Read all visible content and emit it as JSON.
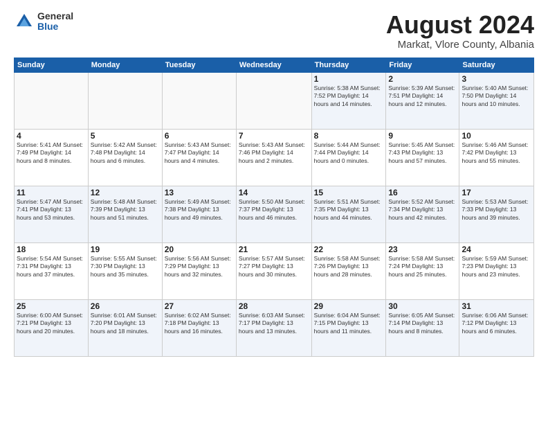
{
  "logo": {
    "general": "General",
    "blue": "Blue"
  },
  "header": {
    "month_year": "August 2024",
    "location": "Markat, Vlore County, Albania"
  },
  "weekdays": [
    "Sunday",
    "Monday",
    "Tuesday",
    "Wednesday",
    "Thursday",
    "Friday",
    "Saturday"
  ],
  "weeks": [
    [
      {
        "day": "",
        "info": ""
      },
      {
        "day": "",
        "info": ""
      },
      {
        "day": "",
        "info": ""
      },
      {
        "day": "",
        "info": ""
      },
      {
        "day": "1",
        "info": "Sunrise: 5:38 AM\nSunset: 7:52 PM\nDaylight: 14 hours\nand 14 minutes."
      },
      {
        "day": "2",
        "info": "Sunrise: 5:39 AM\nSunset: 7:51 PM\nDaylight: 14 hours\nand 12 minutes."
      },
      {
        "day": "3",
        "info": "Sunrise: 5:40 AM\nSunset: 7:50 PM\nDaylight: 14 hours\nand 10 minutes."
      }
    ],
    [
      {
        "day": "4",
        "info": "Sunrise: 5:41 AM\nSunset: 7:49 PM\nDaylight: 14 hours\nand 8 minutes."
      },
      {
        "day": "5",
        "info": "Sunrise: 5:42 AM\nSunset: 7:48 PM\nDaylight: 14 hours\nand 6 minutes."
      },
      {
        "day": "6",
        "info": "Sunrise: 5:43 AM\nSunset: 7:47 PM\nDaylight: 14 hours\nand 4 minutes."
      },
      {
        "day": "7",
        "info": "Sunrise: 5:43 AM\nSunset: 7:46 PM\nDaylight: 14 hours\nand 2 minutes."
      },
      {
        "day": "8",
        "info": "Sunrise: 5:44 AM\nSunset: 7:44 PM\nDaylight: 14 hours\nand 0 minutes."
      },
      {
        "day": "9",
        "info": "Sunrise: 5:45 AM\nSunset: 7:43 PM\nDaylight: 13 hours\nand 57 minutes."
      },
      {
        "day": "10",
        "info": "Sunrise: 5:46 AM\nSunset: 7:42 PM\nDaylight: 13 hours\nand 55 minutes."
      }
    ],
    [
      {
        "day": "11",
        "info": "Sunrise: 5:47 AM\nSunset: 7:41 PM\nDaylight: 13 hours\nand 53 minutes."
      },
      {
        "day": "12",
        "info": "Sunrise: 5:48 AM\nSunset: 7:39 PM\nDaylight: 13 hours\nand 51 minutes."
      },
      {
        "day": "13",
        "info": "Sunrise: 5:49 AM\nSunset: 7:38 PM\nDaylight: 13 hours\nand 49 minutes."
      },
      {
        "day": "14",
        "info": "Sunrise: 5:50 AM\nSunset: 7:37 PM\nDaylight: 13 hours\nand 46 minutes."
      },
      {
        "day": "15",
        "info": "Sunrise: 5:51 AM\nSunset: 7:35 PM\nDaylight: 13 hours\nand 44 minutes."
      },
      {
        "day": "16",
        "info": "Sunrise: 5:52 AM\nSunset: 7:34 PM\nDaylight: 13 hours\nand 42 minutes."
      },
      {
        "day": "17",
        "info": "Sunrise: 5:53 AM\nSunset: 7:33 PM\nDaylight: 13 hours\nand 39 minutes."
      }
    ],
    [
      {
        "day": "18",
        "info": "Sunrise: 5:54 AM\nSunset: 7:31 PM\nDaylight: 13 hours\nand 37 minutes."
      },
      {
        "day": "19",
        "info": "Sunrise: 5:55 AM\nSunset: 7:30 PM\nDaylight: 13 hours\nand 35 minutes."
      },
      {
        "day": "20",
        "info": "Sunrise: 5:56 AM\nSunset: 7:29 PM\nDaylight: 13 hours\nand 32 minutes."
      },
      {
        "day": "21",
        "info": "Sunrise: 5:57 AM\nSunset: 7:27 PM\nDaylight: 13 hours\nand 30 minutes."
      },
      {
        "day": "22",
        "info": "Sunrise: 5:58 AM\nSunset: 7:26 PM\nDaylight: 13 hours\nand 28 minutes."
      },
      {
        "day": "23",
        "info": "Sunrise: 5:58 AM\nSunset: 7:24 PM\nDaylight: 13 hours\nand 25 minutes."
      },
      {
        "day": "24",
        "info": "Sunrise: 5:59 AM\nSunset: 7:23 PM\nDaylight: 13 hours\nand 23 minutes."
      }
    ],
    [
      {
        "day": "25",
        "info": "Sunrise: 6:00 AM\nSunset: 7:21 PM\nDaylight: 13 hours\nand 20 minutes."
      },
      {
        "day": "26",
        "info": "Sunrise: 6:01 AM\nSunset: 7:20 PM\nDaylight: 13 hours\nand 18 minutes."
      },
      {
        "day": "27",
        "info": "Sunrise: 6:02 AM\nSunset: 7:18 PM\nDaylight: 13 hours\nand 16 minutes."
      },
      {
        "day": "28",
        "info": "Sunrise: 6:03 AM\nSunset: 7:17 PM\nDaylight: 13 hours\nand 13 minutes."
      },
      {
        "day": "29",
        "info": "Sunrise: 6:04 AM\nSunset: 7:15 PM\nDaylight: 13 hours\nand 11 minutes."
      },
      {
        "day": "30",
        "info": "Sunrise: 6:05 AM\nSunset: 7:14 PM\nDaylight: 13 hours\nand 8 minutes."
      },
      {
        "day": "31",
        "info": "Sunrise: 6:06 AM\nSunset: 7:12 PM\nDaylight: 13 hours\nand 6 minutes."
      }
    ]
  ]
}
